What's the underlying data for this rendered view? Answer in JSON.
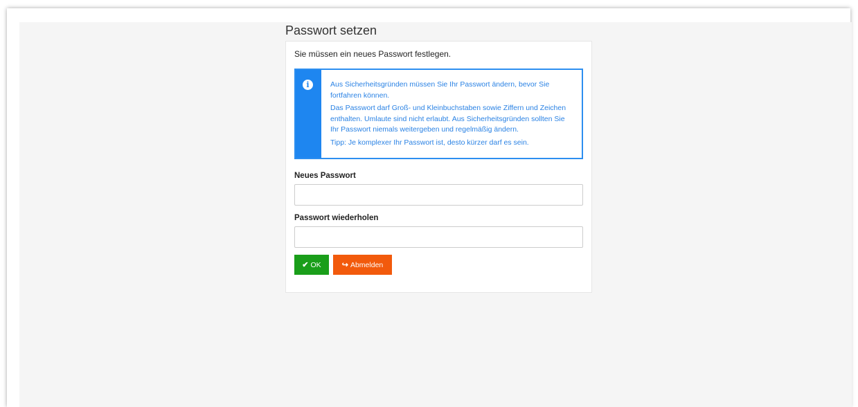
{
  "page": {
    "title": "Passwort setzen"
  },
  "panel": {
    "intro": "Sie müssen ein neues Passwort festlegen.",
    "alert": {
      "icon": "info-icon",
      "icon_glyph": "i",
      "paragraphs": [
        "Aus Sicherheitsgründen müssen Sie Ihr Passwort ändern, bevor Sie fortfahren können.",
        "Das Passwort darf Groß- und Kleinbuchstaben sowie Ziffern und Zeichen enthalten. Umlaute sind nicht erlaubt. Aus Sicherheitsgründen sollten Sie Ihr Passwort niemals weitergeben und regelmäßig ändern.",
        "Tipp: Je komplexer Ihr Passwort ist, desto kürzer darf es sein."
      ]
    },
    "fields": {
      "new_password": {
        "label": "Neues Passwort",
        "value": "",
        "placeholder": ""
      },
      "repeat_password": {
        "label": "Passwort wiederholen",
        "value": "",
        "placeholder": ""
      }
    },
    "buttons": {
      "ok": {
        "label": "OK",
        "icon": "check-icon",
        "glyph": "✔",
        "color": "#1a9e1a"
      },
      "logout": {
        "label": "Abmelden",
        "icon": "sign-out-icon",
        "glyph": "↪",
        "color": "#f25a0c"
      }
    }
  },
  "colors": {
    "info_accent": "#1e86f0",
    "page_background": "#f5f5f5"
  }
}
